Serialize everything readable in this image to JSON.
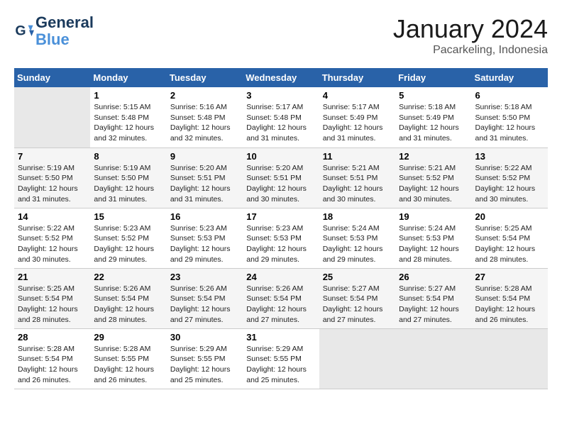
{
  "header": {
    "logo_line1": "General",
    "logo_line2": "Blue",
    "month": "January 2024",
    "location": "Pacarkeling, Indonesia"
  },
  "days_of_week": [
    "Sunday",
    "Monday",
    "Tuesday",
    "Wednesday",
    "Thursday",
    "Friday",
    "Saturday"
  ],
  "weeks": [
    [
      {
        "day": "",
        "empty": true
      },
      {
        "day": "1",
        "sunrise": "5:15 AM",
        "sunset": "5:48 PM",
        "daylight": "12 hours and 32 minutes."
      },
      {
        "day": "2",
        "sunrise": "5:16 AM",
        "sunset": "5:48 PM",
        "daylight": "12 hours and 32 minutes."
      },
      {
        "day": "3",
        "sunrise": "5:17 AM",
        "sunset": "5:48 PM",
        "daylight": "12 hours and 31 minutes."
      },
      {
        "day": "4",
        "sunrise": "5:17 AM",
        "sunset": "5:49 PM",
        "daylight": "12 hours and 31 minutes."
      },
      {
        "day": "5",
        "sunrise": "5:18 AM",
        "sunset": "5:49 PM",
        "daylight": "12 hours and 31 minutes."
      },
      {
        "day": "6",
        "sunrise": "5:18 AM",
        "sunset": "5:50 PM",
        "daylight": "12 hours and 31 minutes."
      }
    ],
    [
      {
        "day": "7",
        "sunrise": "5:19 AM",
        "sunset": "5:50 PM",
        "daylight": "12 hours and 31 minutes."
      },
      {
        "day": "8",
        "sunrise": "5:19 AM",
        "sunset": "5:50 PM",
        "daylight": "12 hours and 31 minutes."
      },
      {
        "day": "9",
        "sunrise": "5:20 AM",
        "sunset": "5:51 PM",
        "daylight": "12 hours and 31 minutes."
      },
      {
        "day": "10",
        "sunrise": "5:20 AM",
        "sunset": "5:51 PM",
        "daylight": "12 hours and 30 minutes."
      },
      {
        "day": "11",
        "sunrise": "5:21 AM",
        "sunset": "5:51 PM",
        "daylight": "12 hours and 30 minutes."
      },
      {
        "day": "12",
        "sunrise": "5:21 AM",
        "sunset": "5:52 PM",
        "daylight": "12 hours and 30 minutes."
      },
      {
        "day": "13",
        "sunrise": "5:22 AM",
        "sunset": "5:52 PM",
        "daylight": "12 hours and 30 minutes."
      }
    ],
    [
      {
        "day": "14",
        "sunrise": "5:22 AM",
        "sunset": "5:52 PM",
        "daylight": "12 hours and 30 minutes."
      },
      {
        "day": "15",
        "sunrise": "5:23 AM",
        "sunset": "5:52 PM",
        "daylight": "12 hours and 29 minutes."
      },
      {
        "day": "16",
        "sunrise": "5:23 AM",
        "sunset": "5:53 PM",
        "daylight": "12 hours and 29 minutes."
      },
      {
        "day": "17",
        "sunrise": "5:23 AM",
        "sunset": "5:53 PM",
        "daylight": "12 hours and 29 minutes."
      },
      {
        "day": "18",
        "sunrise": "5:24 AM",
        "sunset": "5:53 PM",
        "daylight": "12 hours and 29 minutes."
      },
      {
        "day": "19",
        "sunrise": "5:24 AM",
        "sunset": "5:53 PM",
        "daylight": "12 hours and 28 minutes."
      },
      {
        "day": "20",
        "sunrise": "5:25 AM",
        "sunset": "5:54 PM",
        "daylight": "12 hours and 28 minutes."
      }
    ],
    [
      {
        "day": "21",
        "sunrise": "5:25 AM",
        "sunset": "5:54 PM",
        "daylight": "12 hours and 28 minutes."
      },
      {
        "day": "22",
        "sunrise": "5:26 AM",
        "sunset": "5:54 PM",
        "daylight": "12 hours and 28 minutes."
      },
      {
        "day": "23",
        "sunrise": "5:26 AM",
        "sunset": "5:54 PM",
        "daylight": "12 hours and 27 minutes."
      },
      {
        "day": "24",
        "sunrise": "5:26 AM",
        "sunset": "5:54 PM",
        "daylight": "12 hours and 27 minutes."
      },
      {
        "day": "25",
        "sunrise": "5:27 AM",
        "sunset": "5:54 PM",
        "daylight": "12 hours and 27 minutes."
      },
      {
        "day": "26",
        "sunrise": "5:27 AM",
        "sunset": "5:54 PM",
        "daylight": "12 hours and 27 minutes."
      },
      {
        "day": "27",
        "sunrise": "5:28 AM",
        "sunset": "5:54 PM",
        "daylight": "12 hours and 26 minutes."
      }
    ],
    [
      {
        "day": "28",
        "sunrise": "5:28 AM",
        "sunset": "5:54 PM",
        "daylight": "12 hours and 26 minutes."
      },
      {
        "day": "29",
        "sunrise": "5:28 AM",
        "sunset": "5:55 PM",
        "daylight": "12 hours and 26 minutes."
      },
      {
        "day": "30",
        "sunrise": "5:29 AM",
        "sunset": "5:55 PM",
        "daylight": "12 hours and 25 minutes."
      },
      {
        "day": "31",
        "sunrise": "5:29 AM",
        "sunset": "5:55 PM",
        "daylight": "12 hours and 25 minutes."
      },
      {
        "day": "",
        "empty": true
      },
      {
        "day": "",
        "empty": true
      },
      {
        "day": "",
        "empty": true
      }
    ]
  ]
}
